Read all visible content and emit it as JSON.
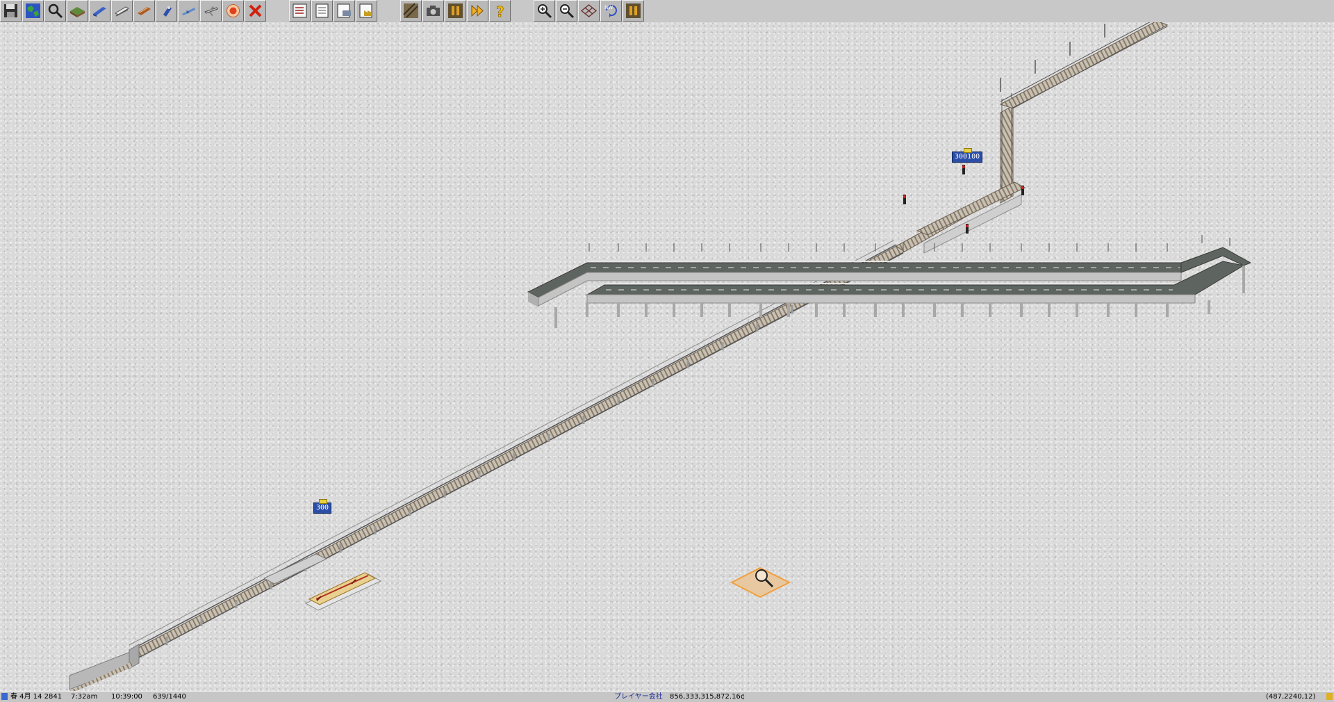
{
  "toolbar": {
    "groups": [
      {
        "name": "main",
        "buttons": [
          "save-icon",
          "globe-icon",
          "magnifier-icon",
          "terrain-icon",
          "rail-tools-icon",
          "maglev-tools-icon",
          "road-tools-icon",
          "ship-tools-icon",
          "air-tools-icon",
          "airplane-icon",
          "target-icon",
          "remove-icon"
        ]
      },
      {
        "name": "lists",
        "buttons": [
          "line-management-icon",
          "list-icon",
          "convoy-list-icon",
          "factory-list-icon"
        ]
      },
      {
        "name": "view",
        "buttons": [
          "rail-view-icon",
          "camera-icon",
          "pause-icon",
          "fast-forward-icon",
          "help-icon"
        ]
      },
      {
        "name": "zoom",
        "buttons": [
          "zoom-in-icon",
          "zoom-out-icon",
          "grid-icon",
          "rotate-icon",
          "pause-small-icon"
        ]
      }
    ]
  },
  "map": {
    "signs": {
      "upper": "300100",
      "lower": "300"
    },
    "colors": {
      "ground": "#dadada",
      "rail_bed": "#c9c3b8",
      "rail_steel": "#6b5f52",
      "road": "#5e6460",
      "viaduct": "#bdbdbd",
      "cursor": "#f0a040"
    }
  },
  "statusbar": {
    "season_date": "春 4月 14 2841",
    "clock": "7:32am",
    "timer": "10:39:00",
    "tiles": "639/1440",
    "player": "プレイヤー会社",
    "money": "856,333,315,872.16¢",
    "coords": "(487,2240,12)"
  }
}
